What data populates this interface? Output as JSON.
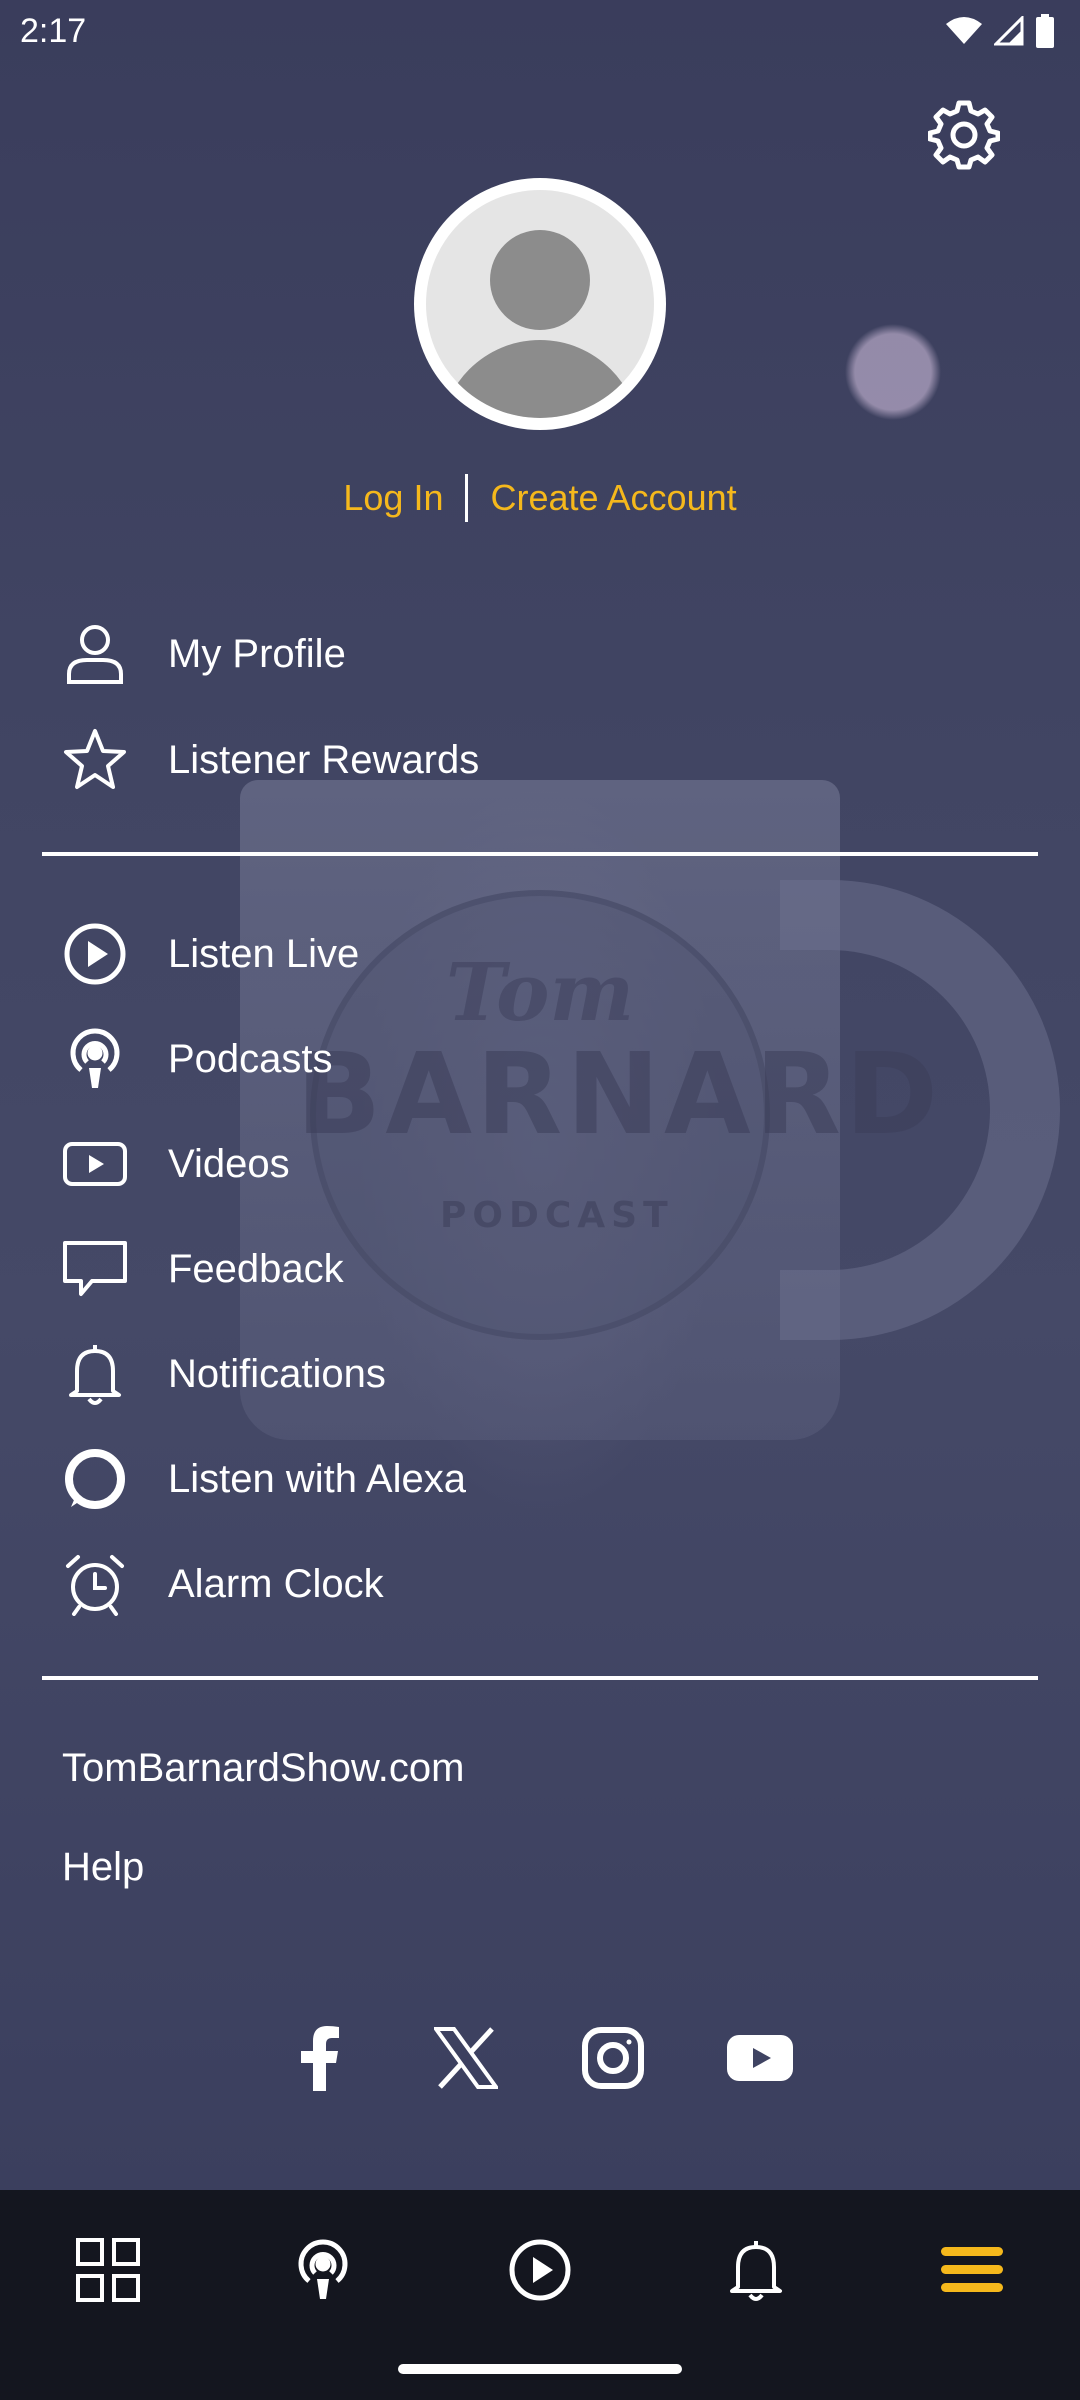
{
  "status_bar": {
    "time": "2:17",
    "icons": [
      "wifi-icon",
      "signal-icon",
      "battery-icon"
    ]
  },
  "header": {
    "settings_icon": "gear-icon"
  },
  "auth": {
    "login_label": "Log In",
    "create_account_label": "Create Account",
    "accent_color": "#f5b81c"
  },
  "menu": {
    "account_items": [
      {
        "label": "My Profile",
        "icon": "person-icon"
      },
      {
        "label": "Listener Rewards",
        "icon": "star-icon"
      }
    ],
    "main_items": [
      {
        "label": "Listen Live",
        "icon": "play-circle-icon"
      },
      {
        "label": "Podcasts",
        "icon": "podcast-icon"
      },
      {
        "label": "Videos",
        "icon": "video-icon"
      },
      {
        "label": "Feedback",
        "icon": "chat-bubble-icon"
      },
      {
        "label": "Notifications",
        "icon": "bell-icon"
      },
      {
        "label": "Listen with Alexa",
        "icon": "alexa-icon"
      },
      {
        "label": "Alarm Clock",
        "icon": "alarm-clock-icon"
      }
    ]
  },
  "links": {
    "website": "TomBarnardShow.com",
    "help": "Help"
  },
  "social": [
    "facebook-icon",
    "x-icon",
    "instagram-icon",
    "youtube-icon"
  ],
  "bottom_nav": {
    "items": [
      "grid-icon",
      "podcast-icon",
      "play-circle-icon",
      "bell-icon",
      "menu-icon"
    ],
    "active_index": 4,
    "active_color": "#f5b81c"
  },
  "background": {
    "mug_text_top": "Tom",
    "mug_text_main": "BARNARD",
    "mug_text_bottom": "PODCAST"
  }
}
